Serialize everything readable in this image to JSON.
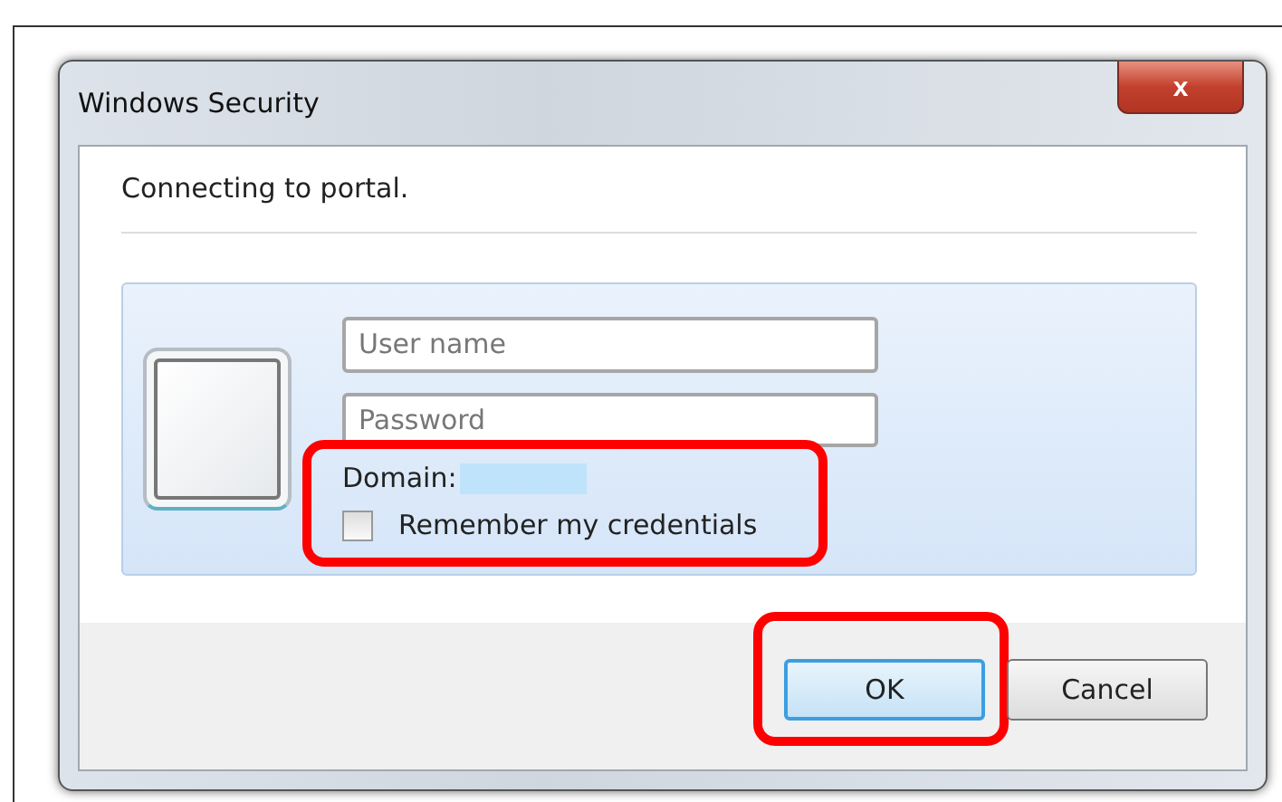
{
  "window": {
    "title": "Windows Security",
    "close": "x"
  },
  "message": "Connecting to portal.",
  "fields": [
    {
      "placeholder": "User name"
    },
    {
      "placeholder": "Password"
    }
  ],
  "options": {
    "highlighted": true,
    "domain_label": "Domain:",
    "remember": {
      "label": "Remember my credentials",
      "checked": false
    }
  },
  "buttons": [
    {
      "label": "OK",
      "default": true,
      "highlighted": true
    },
    {
      "label": "Cancel",
      "default": false
    }
  ]
}
